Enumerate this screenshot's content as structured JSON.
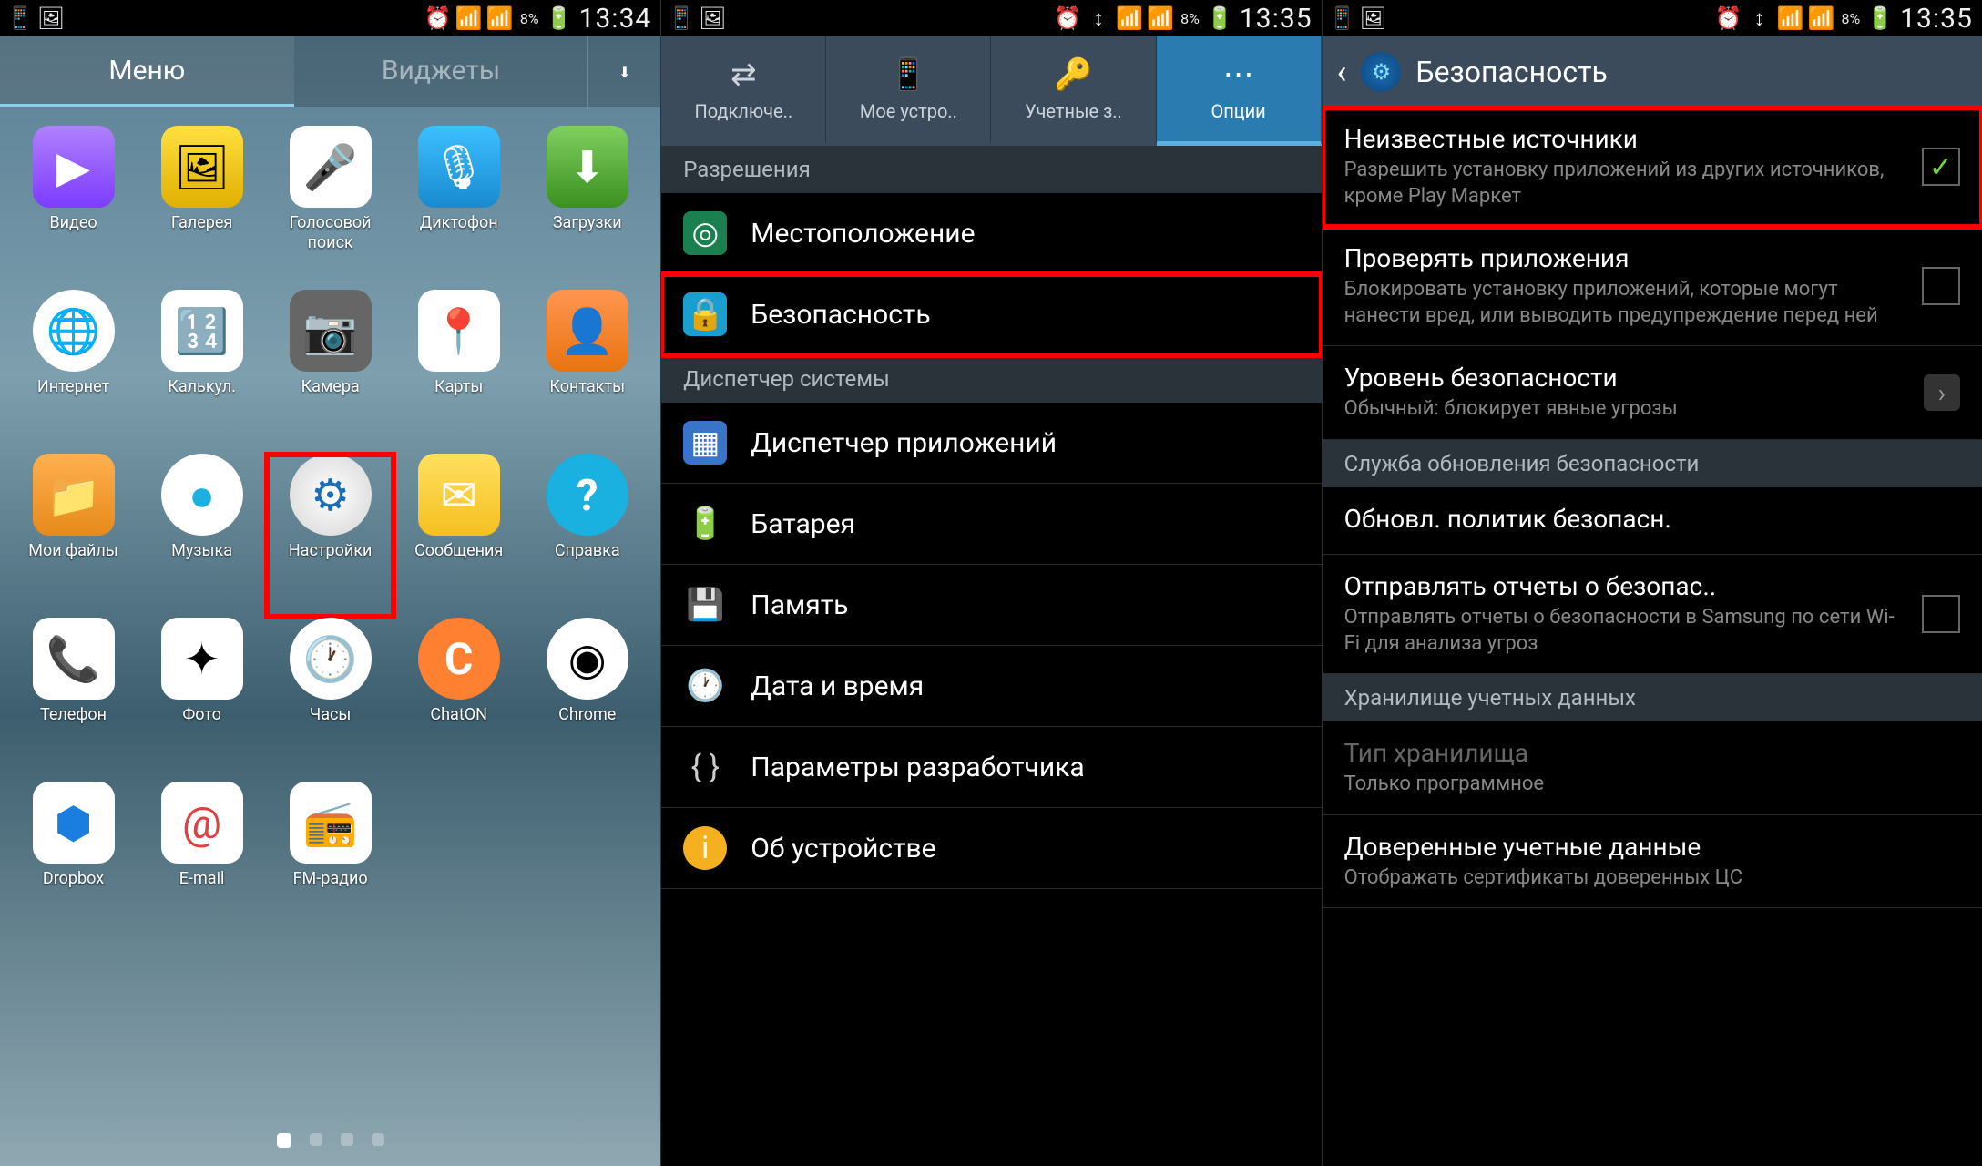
{
  "phone1": {
    "statusbar": {
      "battery_pct": "8%",
      "time": "13:34"
    },
    "tabs": {
      "menu": "Меню",
      "widgets": "Виджеты"
    },
    "apps": [
      {
        "name": "Видео",
        "icon": "▶",
        "cls": "ic-video"
      },
      {
        "name": "Галерея",
        "icon": "🖼",
        "cls": "ic-gallery"
      },
      {
        "name": "Голосовой поиск",
        "icon": "🎤",
        "cls": "ic-voice"
      },
      {
        "name": "Диктофон",
        "icon": "🎙",
        "cls": "ic-recorder"
      },
      {
        "name": "Загрузки",
        "icon": "⬇",
        "cls": "ic-downloads"
      },
      {
        "name": "Интернет",
        "icon": "🌐",
        "cls": "ic-internet"
      },
      {
        "name": "Калькул.",
        "icon": "🔢",
        "cls": "ic-calc"
      },
      {
        "name": "Камера",
        "icon": "📷",
        "cls": "ic-camera"
      },
      {
        "name": "Карты",
        "icon": "📍",
        "cls": "ic-maps"
      },
      {
        "name": "Контакты",
        "icon": "👤",
        "cls": "ic-contacts"
      },
      {
        "name": "Мои файлы",
        "icon": "📁",
        "cls": "ic-files"
      },
      {
        "name": "Музыка",
        "icon": "●",
        "cls": "ic-music"
      },
      {
        "name": "Настройки",
        "icon": "⚙",
        "cls": "ic-settings",
        "highlight": true
      },
      {
        "name": "Сообщения",
        "icon": "✉",
        "cls": "ic-messages"
      },
      {
        "name": "Справка",
        "icon": "?",
        "cls": "ic-help"
      },
      {
        "name": "Телефон",
        "icon": "📞",
        "cls": "ic-phone"
      },
      {
        "name": "Фото",
        "icon": "✦",
        "cls": "ic-photo"
      },
      {
        "name": "Часы",
        "icon": "🕐",
        "cls": "ic-clock"
      },
      {
        "name": "ChatON",
        "icon": "C",
        "cls": "ic-chaton"
      },
      {
        "name": "Chrome",
        "icon": "◉",
        "cls": "ic-chrome"
      },
      {
        "name": "Dropbox",
        "icon": "⬢",
        "cls": "ic-dropbox"
      },
      {
        "name": "E-mail",
        "icon": "@",
        "cls": "ic-email"
      },
      {
        "name": "FM-радио",
        "icon": "📻",
        "cls": "ic-fm"
      }
    ]
  },
  "phone2": {
    "statusbar": {
      "battery_pct": "8%",
      "time": "13:35"
    },
    "tabs": [
      {
        "label": "Подключе..",
        "icon": "⇄"
      },
      {
        "label": "Мое устро..",
        "icon": "📱"
      },
      {
        "label": "Учетные з..",
        "icon": "🔑"
      },
      {
        "label": "Опции",
        "icon": "⋯",
        "active": true
      }
    ],
    "section_permissions": "Разрешения",
    "item_location": "Местоположение",
    "item_security": "Безопасность",
    "section_system": "Диспетчер системы",
    "item_appmgr": "Диспетчер приложений",
    "item_battery": "Батарея",
    "item_storage": "Память",
    "item_datetime": "Дата и время",
    "item_devopts": "Параметры разработчика",
    "item_about": "Об устройстве"
  },
  "phone3": {
    "statusbar": {
      "battery_pct": "8%",
      "time": "13:35"
    },
    "title": "Безопасность",
    "prefs": {
      "unknown": {
        "title": "Неизвестные источники",
        "sub": "Разрешить установку приложений из других источников, кроме Play Маркет",
        "checked": true,
        "highlight": true
      },
      "verify": {
        "title": "Проверять приложения",
        "sub": "Блокировать установку приложений, которые могут нанести вред, или выводить предупреждение перед ней",
        "checked": false
      },
      "level": {
        "title": "Уровень безопасности",
        "sub": "Обычный: блокирует явные угрозы",
        "chevron": true
      },
      "section_update": "Служба обновления безопасности",
      "policy": {
        "title": "Обновл. политик безопасн."
      },
      "reports": {
        "title": "Отправлять отчеты о безопас..",
        "sub": "Отправлять отчеты о безопасности в Samsung по сети Wi-Fi для анализа угроз",
        "checked": false
      },
      "section_creds": "Хранилище учетных данных",
      "storage_type": {
        "title": "Тип хранилища",
        "sub": "Только программное",
        "disabled": true
      },
      "trusted": {
        "title": "Доверенные учетные данные",
        "sub": "Отображать сертификаты доверенных ЦС"
      }
    }
  }
}
